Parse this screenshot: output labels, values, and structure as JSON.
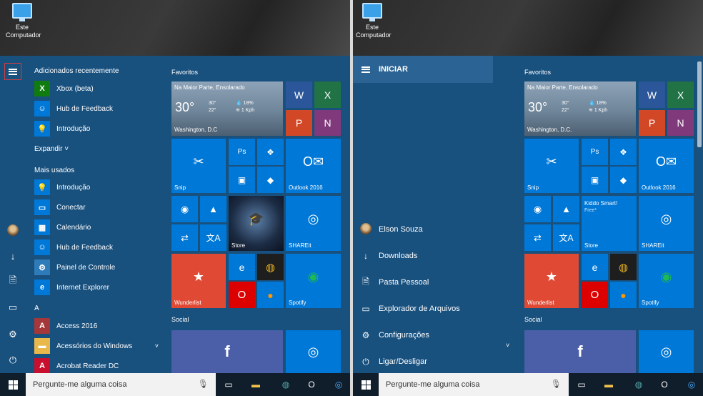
{
  "desktop": {
    "icon_label": "Este Computador"
  },
  "left": {
    "recent_title": "Adicionados recentemente",
    "recent": [
      {
        "label": "Xbox (beta)",
        "color": "#107c10",
        "glyph": "X"
      },
      {
        "label": "Hub de Feedback",
        "color": "#0078d7",
        "glyph": "☺"
      },
      {
        "label": "Introdução",
        "color": "#0078d7",
        "glyph": "💡"
      }
    ],
    "expand": "Expandir",
    "most_used_title": "Mais usados",
    "most_used": [
      {
        "label": "Introdução",
        "color": "#0078d7",
        "glyph": "💡"
      },
      {
        "label": "Conectar",
        "color": "#0078d7",
        "glyph": "▭"
      },
      {
        "label": "Calendário",
        "color": "#0078d7",
        "glyph": "▦"
      },
      {
        "label": "Hub de Feedback",
        "color": "#0078d7",
        "glyph": "☺"
      },
      {
        "label": "Painel de Controle",
        "color": "#2d7bb8",
        "glyph": "⚙"
      },
      {
        "label": "Internet Explorer",
        "color": "#0078d7",
        "glyph": "e"
      }
    ],
    "letter": "A",
    "alpha": [
      {
        "label": "Access 2016",
        "color": "#a4373a",
        "glyph": "A"
      },
      {
        "label": "Acessórios do Windows",
        "color": "#e8b94a",
        "glyph": "▬"
      },
      {
        "label": "Acrobat Reader DC",
        "color": "#c8102e",
        "glyph": "A"
      }
    ]
  },
  "right": {
    "header": "INICIAR",
    "items": [
      {
        "label": "Elson Souza",
        "icon": "avatar"
      },
      {
        "label": "Downloads",
        "icon": "↓"
      },
      {
        "label": "Pasta Pessoal",
        "icon": "🗎"
      },
      {
        "label": "Explorador de Arquivos",
        "icon": "▭"
      },
      {
        "label": "Configurações",
        "icon": "⚙"
      },
      {
        "label": "Ligar/Desligar",
        "icon": "⏻"
      }
    ]
  },
  "tiles": {
    "favorites": "Favoritos",
    "social": "Social",
    "weather": {
      "condition": "Na Maior Parte, Ensolarado",
      "temp": "30°",
      "high": "30°",
      "low": "22°",
      "humidity": "18%",
      "wind": "1 Kph",
      "city_left": "Washington, D.C",
      "city_right": "Washington, D.C."
    },
    "snip": "Snip",
    "outlook": "Outlook 2016",
    "store": "Store",
    "shareit": "SHAREit",
    "wunderlist": "Wunderlist",
    "spotify": "Spotify",
    "kiddo_title": "Kiddo Smart!",
    "kiddo_sub": "Free*"
  },
  "taskbar": {
    "search_placeholder": "Pergunte-me alguma coisa"
  },
  "colors": {
    "start_bg": "#18507e",
    "tile_blue": "#0078d7",
    "taskbar": "#101d2b"
  }
}
